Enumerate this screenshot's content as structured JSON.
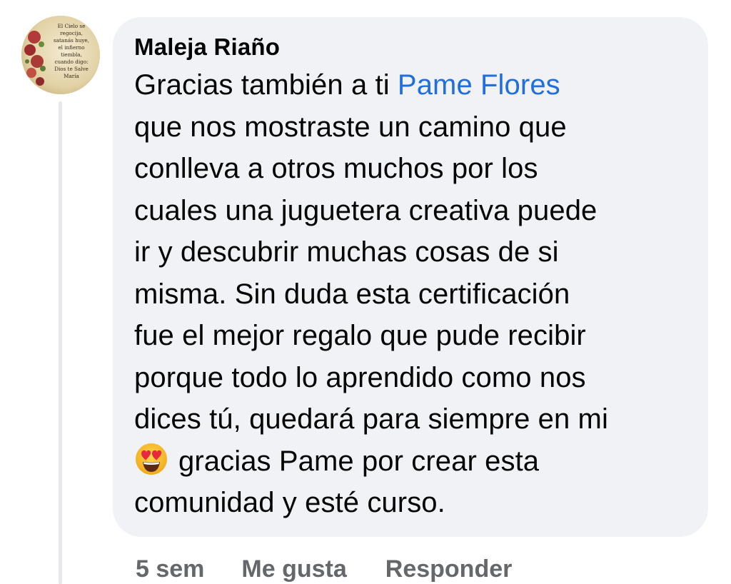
{
  "comment": {
    "author": "Maleja Riaño",
    "avatar_text": [
      "El Cielo se",
      "regocija,",
      "satanás huye,",
      "el infierno",
      "tiembla,",
      "cuando digo:",
      "Dios te Salve",
      "María"
    ],
    "mention": "Pame Flores",
    "lines": [
      "Gracias también a ti ",
      "que nos mostraste un camino que",
      "conlleva a otros muchos por los",
      "cuales una juguetera creativa puede",
      "ir y descubrir muchas cosas de si",
      "misma. Sin duda esta certificación",
      "fue el mejor regalo que pude recibir",
      "porque todo lo aprendido como nos",
      "dices tú, quedará para siempre en mi",
      "gracias Pame por crear esta",
      "comunidad y esté curso."
    ],
    "emoji": "heart-eyes-emoji",
    "time": "5 sem",
    "like_label": "Me gusta",
    "reply_label": "Responder"
  },
  "colors": {
    "bubble": "#f0f2f5",
    "mention": "#216fdb",
    "meta": "#65676b",
    "text": "#050505"
  }
}
